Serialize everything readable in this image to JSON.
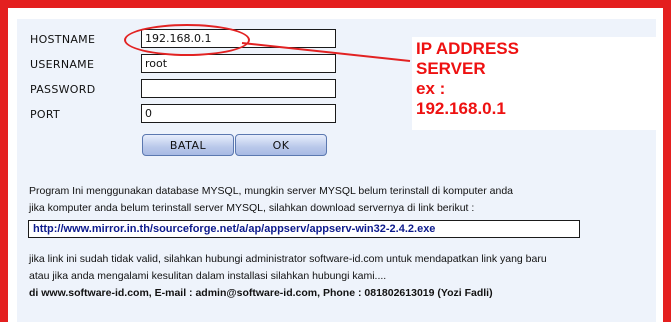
{
  "form": {
    "hostname_label": "HOSTNAME",
    "hostname_value": "192.168.0.1",
    "username_label": "USERNAME",
    "username_value": "root",
    "password_label": "PASSWORD",
    "password_value": "",
    "port_label": "PORT",
    "port_value": "0",
    "cancel_label": "BATAL",
    "ok_label": "OK"
  },
  "annotation": {
    "line1": "IP ADDRESS",
    "line2": "SERVER",
    "line3": "ex :",
    "line4": "192.168.0.1",
    "color": "#ee1111"
  },
  "info": {
    "line1": "Program Ini menggunakan database MYSQL, mungkin server MYSQL belum terinstall di komputer anda",
    "line2": "jika komputer anda belum terinstall server MYSQL, silahkan download servernya di link berikut :",
    "download_link": "http://www.mirror.in.th/sourceforge.net/a/ap/appserv/appserv-win32-2.4.2.exe",
    "line3": "jika link ini sudah tidak valid, silahkan hubungi administrator software-id.com untuk mendapatkan link yang baru",
    "line4": "atau jika anda mengalami kesulitan dalam installasi silahkan hubungi kami....",
    "contact": "di www.software-id.com, E-mail : admin@software-id.com, Phone : 081802613019 (Yozi Fadli)"
  },
  "colors": {
    "frame": "#e41f1f",
    "panel": "#eef3fb"
  }
}
